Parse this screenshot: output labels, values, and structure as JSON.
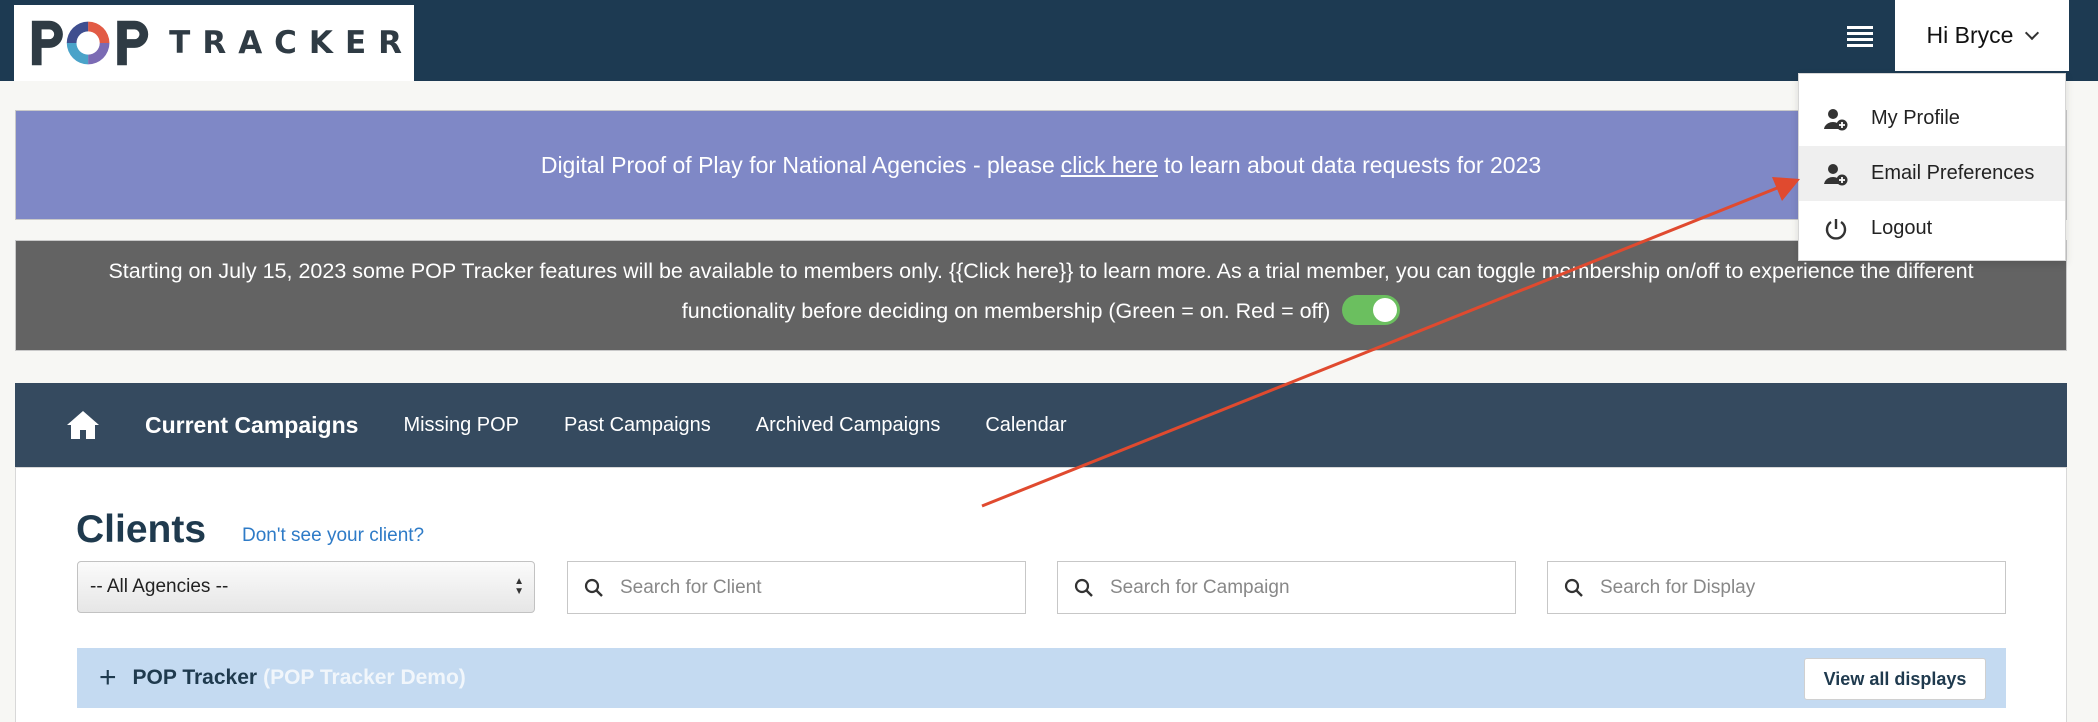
{
  "header": {
    "logo_pop": "POP",
    "logo_tracker": "TRACKER",
    "user_greeting": "Hi Bryce"
  },
  "user_menu": {
    "items": [
      {
        "label": "My Profile",
        "icon": "user-plus-icon"
      },
      {
        "label": "Email Preferences",
        "icon": "user-plus-icon"
      },
      {
        "label": "Logout",
        "icon": "power-icon"
      }
    ]
  },
  "banner_notice": {
    "text_before": "Digital Proof of Play for National Agencies - please",
    "link": "click here",
    "text_after": "to learn about data requests for 2023"
  },
  "membership_notice": {
    "line1": "Starting on July 15, 2023 some POP Tracker features will be available to members only. {{Click here}} to learn more. As a trial member, you can toggle membership on/off to experience the different",
    "line2": "functionality before deciding on membership (Green = on. Red = off)",
    "toggle_state": "on"
  },
  "nav": {
    "tabs": [
      "Current Campaigns",
      "Missing POP",
      "Past Campaigns",
      "Archived Campaigns",
      "Calendar"
    ],
    "active": "Current Campaigns"
  },
  "clients": {
    "title": "Clients",
    "help_link": "Don't see your client?",
    "agency_select": "-- All Agencies --",
    "search_client_placeholder": "Search for Client",
    "search_campaign_placeholder": "Search for Campaign",
    "search_display_placeholder": "Search for Display",
    "rows": [
      {
        "name": "POP Tracker",
        "sub": "(POP Tracker Demo)",
        "button": "View all displays"
      }
    ]
  },
  "colors": {
    "topbar": "#1d3a52",
    "banner_blue": "#7f88c6",
    "banner_gray": "#636363",
    "nav": "#354a5f",
    "toggle_on": "#6bbf5f",
    "annotation_arrow": "#e04a2f"
  }
}
